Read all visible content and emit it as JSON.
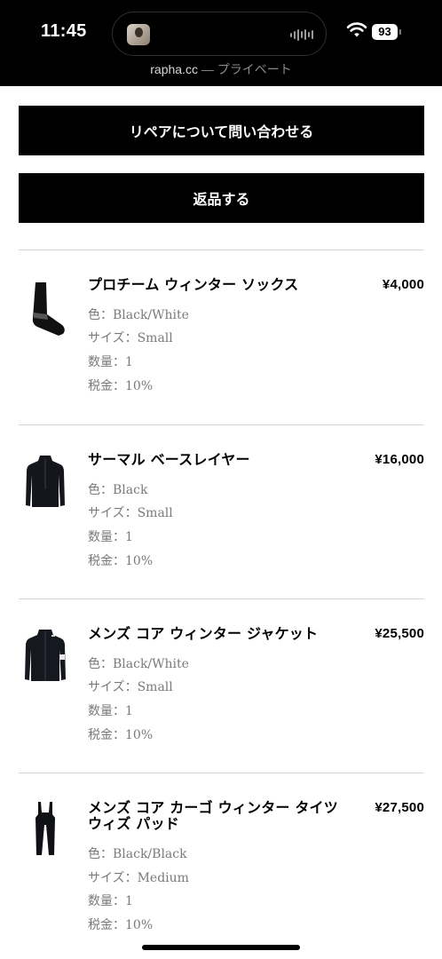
{
  "status_bar": {
    "time": "11:45",
    "battery": "93"
  },
  "browser": {
    "host": "rapha.cc",
    "separator": " — ",
    "mode": "プライベート"
  },
  "actions": {
    "repair_label": "リペアについて問い合わせる",
    "return_label": "返品する"
  },
  "items": [
    {
      "name": "プロチーム ウィンター ソックス",
      "price": "¥4,000",
      "color_label": "色：",
      "color": "Black/White",
      "size_label": "サイズ：",
      "size": "Small",
      "qty_label": "数量：",
      "qty": "1",
      "tax_label": "税金：",
      "tax": "10%",
      "thumb_icon": "sock-icon"
    },
    {
      "name": "サーマル ベースレイヤー",
      "price": "¥16,000",
      "color_label": "色：",
      "color": "Black",
      "size_label": "サイズ：",
      "size": "Small",
      "qty_label": "数量：",
      "qty": "1",
      "tax_label": "税金：",
      "tax": "10%",
      "thumb_icon": "baselayer-icon"
    },
    {
      "name": "メンズ コア ウィンター ジャケット",
      "price": "¥25,500",
      "color_label": "色：",
      "color": "Black/White",
      "size_label": "サイズ：",
      "size": "Small",
      "qty_label": "数量：",
      "qty": "1",
      "tax_label": "税金：",
      "tax": "10%",
      "thumb_icon": "jacket-icon"
    },
    {
      "name": "メンズ コア カーゴ ウィンター タイツ ウィズ パッド",
      "price": "¥27,500",
      "color_label": "色：",
      "color": "Black/Black",
      "size_label": "サイズ：",
      "size": "Medium",
      "qty_label": "数量：",
      "qty": "1",
      "tax_label": "税金：",
      "tax": "10%",
      "thumb_icon": "bib-tights-icon"
    }
  ]
}
